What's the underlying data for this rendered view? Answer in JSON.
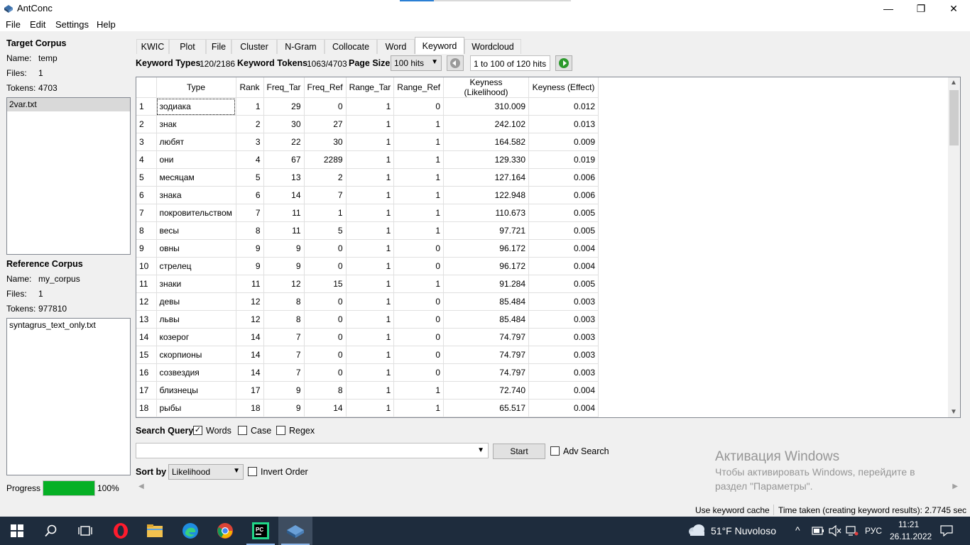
{
  "window": {
    "title": "AntConc",
    "minimize": "—",
    "restore": "❐",
    "close": "✕"
  },
  "menu": [
    "File",
    "Edit",
    "Settings",
    "Help"
  ],
  "target_corpus": {
    "heading": "Target Corpus",
    "name_label": "Name:",
    "name": "temp",
    "files_label": "Files:",
    "files": "1",
    "tokens_label": "Tokens:",
    "tokens": "4703",
    "files_list": [
      "2var.txt"
    ]
  },
  "reference_corpus": {
    "heading": "Reference Corpus",
    "name_label": "Name:",
    "name": "my_corpus",
    "files_label": "Files:",
    "files": "1",
    "tokens_label": "Tokens:",
    "tokens": "977810",
    "files_list": [
      "syntagrus_text_only.txt"
    ]
  },
  "progress": {
    "label": "Progress",
    "value_text": "100%",
    "value": 1.0,
    "color": "#06b025"
  },
  "tabs": [
    "KWIC",
    "Plot",
    "File",
    "Cluster",
    "N-Gram",
    "Collocate",
    "Word",
    "Keyword",
    "Wordcloud"
  ],
  "active_tab": "Keyword",
  "toolbar": {
    "keyword_types_label": "Keyword Types",
    "keyword_types": "120/2186",
    "keyword_tokens_label": "Keyword Tokens",
    "keyword_tokens": "1063/4703",
    "page_size_label": "Page Size",
    "page_size": "100 hits",
    "hits_range": "1 to 100 of 120 hits"
  },
  "table": {
    "columns": [
      "Type",
      "Rank",
      "Freq_Tar",
      "Freq_Ref",
      "Range_Tar",
      "Range_Ref",
      "Keyness (Likelihood)",
      "Keyness (Effect)"
    ],
    "rows": [
      [
        "1",
        "зодиака",
        "1",
        "29",
        "0",
        "1",
        "0",
        "310.009",
        "0.012"
      ],
      [
        "2",
        "знак",
        "2",
        "30",
        "27",
        "1",
        "1",
        "242.102",
        "0.013"
      ],
      [
        "3",
        "любят",
        "3",
        "22",
        "30",
        "1",
        "1",
        "164.582",
        "0.009"
      ],
      [
        "4",
        "они",
        "4",
        "67",
        "2289",
        "1",
        "1",
        "129.330",
        "0.019"
      ],
      [
        "5",
        "месяцам",
        "5",
        "13",
        "2",
        "1",
        "1",
        "127.164",
        "0.006"
      ],
      [
        "6",
        "знака",
        "6",
        "14",
        "7",
        "1",
        "1",
        "122.948",
        "0.006"
      ],
      [
        "7",
        "покровительством",
        "7",
        "11",
        "1",
        "1",
        "1",
        "110.673",
        "0.005"
      ],
      [
        "8",
        "весы",
        "8",
        "11",
        "5",
        "1",
        "1",
        "97.721",
        "0.005"
      ],
      [
        "9",
        "овны",
        "9",
        "9",
        "0",
        "1",
        "0",
        "96.172",
        "0.004"
      ],
      [
        "10",
        "стрелец",
        "9",
        "9",
        "0",
        "1",
        "0",
        "96.172",
        "0.004"
      ],
      [
        "11",
        "знаки",
        "11",
        "12",
        "15",
        "1",
        "1",
        "91.284",
        "0.005"
      ],
      [
        "12",
        "девы",
        "12",
        "8",
        "0",
        "1",
        "0",
        "85.484",
        "0.003"
      ],
      [
        "13",
        "львы",
        "12",
        "8",
        "0",
        "1",
        "0",
        "85.484",
        "0.003"
      ],
      [
        "14",
        "козерог",
        "14",
        "7",
        "0",
        "1",
        "0",
        "74.797",
        "0.003"
      ],
      [
        "15",
        "скорпионы",
        "14",
        "7",
        "0",
        "1",
        "0",
        "74.797",
        "0.003"
      ],
      [
        "16",
        "созвездия",
        "14",
        "7",
        "0",
        "1",
        "0",
        "74.797",
        "0.003"
      ],
      [
        "17",
        "близнецы",
        "17",
        "9",
        "8",
        "1",
        "1",
        "72.740",
        "0.004"
      ],
      [
        "18",
        "рыбы",
        "18",
        "9",
        "14",
        "1",
        "1",
        "65.517",
        "0.004"
      ]
    ]
  },
  "search": {
    "query_label": "Search Query",
    "words_label": "Words",
    "words_checked": true,
    "case_label": "Case",
    "case_checked": false,
    "regex_label": "Regex",
    "regex_checked": false,
    "query_value": "",
    "start_label": "Start",
    "adv_search_label": "Adv Search",
    "adv_checked": false
  },
  "sort": {
    "label": "Sort by",
    "value": "Likelihood",
    "invert_label": "Invert Order",
    "invert_checked": false
  },
  "watermark": {
    "line1": "Активация Windows",
    "line2": "Чтобы активировать Windows, перейдите в",
    "line3": "раздел \"Параметры\"."
  },
  "statusbar": {
    "cache": "Use keyword cache",
    "time": "Time taken (creating keyword results):  2.7745 sec"
  },
  "taskbar": {
    "weather": "51°F  Nuvoloso",
    "lang": "РУС",
    "time": "11:21",
    "date": "26.11.2022"
  }
}
